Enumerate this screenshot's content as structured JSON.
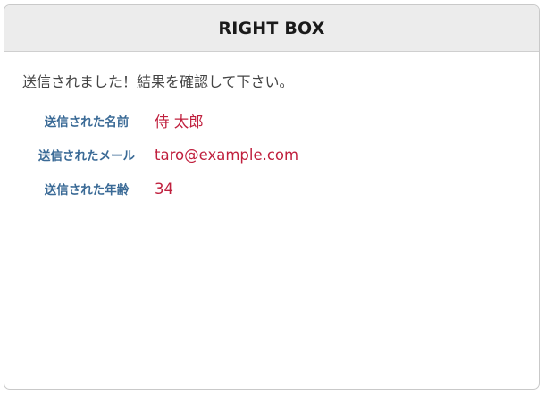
{
  "box": {
    "title": "RIGHT BOX",
    "message": "送信されました！結果を確認して下さい。"
  },
  "results": {
    "name_label": "送信された名前",
    "name_value": "侍 太郎",
    "email_label": "送信されたメール",
    "email_value": "taro@example.com",
    "age_label": "送信された年齢",
    "age_value": "34"
  },
  "colors": {
    "header_bg": "#ececec",
    "label": "#3a6a96",
    "value": "#c0203e",
    "text": "#444444"
  }
}
